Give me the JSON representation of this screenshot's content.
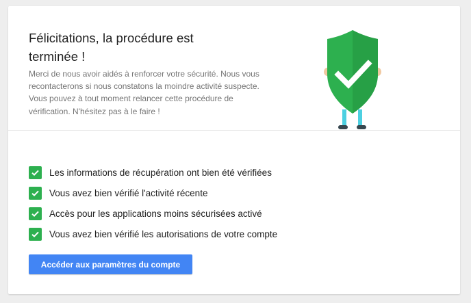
{
  "header": {
    "title": "Félicitations, la procédure est terminée !",
    "description": "Merci de nous avoir aidés à renforcer votre sécurité. Nous vous recontacterons si nous constatons la moindre activité suspecte. Vous pouvez à tout moment relancer cette procédure de vérification. N'hésitez pas à le faire !"
  },
  "illustration": {
    "icon": "shield-checkmark-icon",
    "shield_color": "#2db04f",
    "shield_shade_color": "#27a046",
    "legs_color": "#4dd0e1",
    "shoes_color": "#37474f",
    "hands_color": "#f0c8a0"
  },
  "checklist": {
    "checkbox_color": "#2db04f",
    "items": [
      {
        "label": "Les informations de récupération ont bien été vérifiées",
        "checked": true
      },
      {
        "label": "Vous avez bien vérifié l'activité récente",
        "checked": true
      },
      {
        "label": "Accès pour les applications moins sécurisées activé",
        "checked": true
      },
      {
        "label": "Vous avez bien vérifié les autorisations de votre compte",
        "checked": true
      }
    ]
  },
  "actions": {
    "primary_label": "Accéder aux paramètres du compte",
    "primary_color": "#4285f4"
  }
}
